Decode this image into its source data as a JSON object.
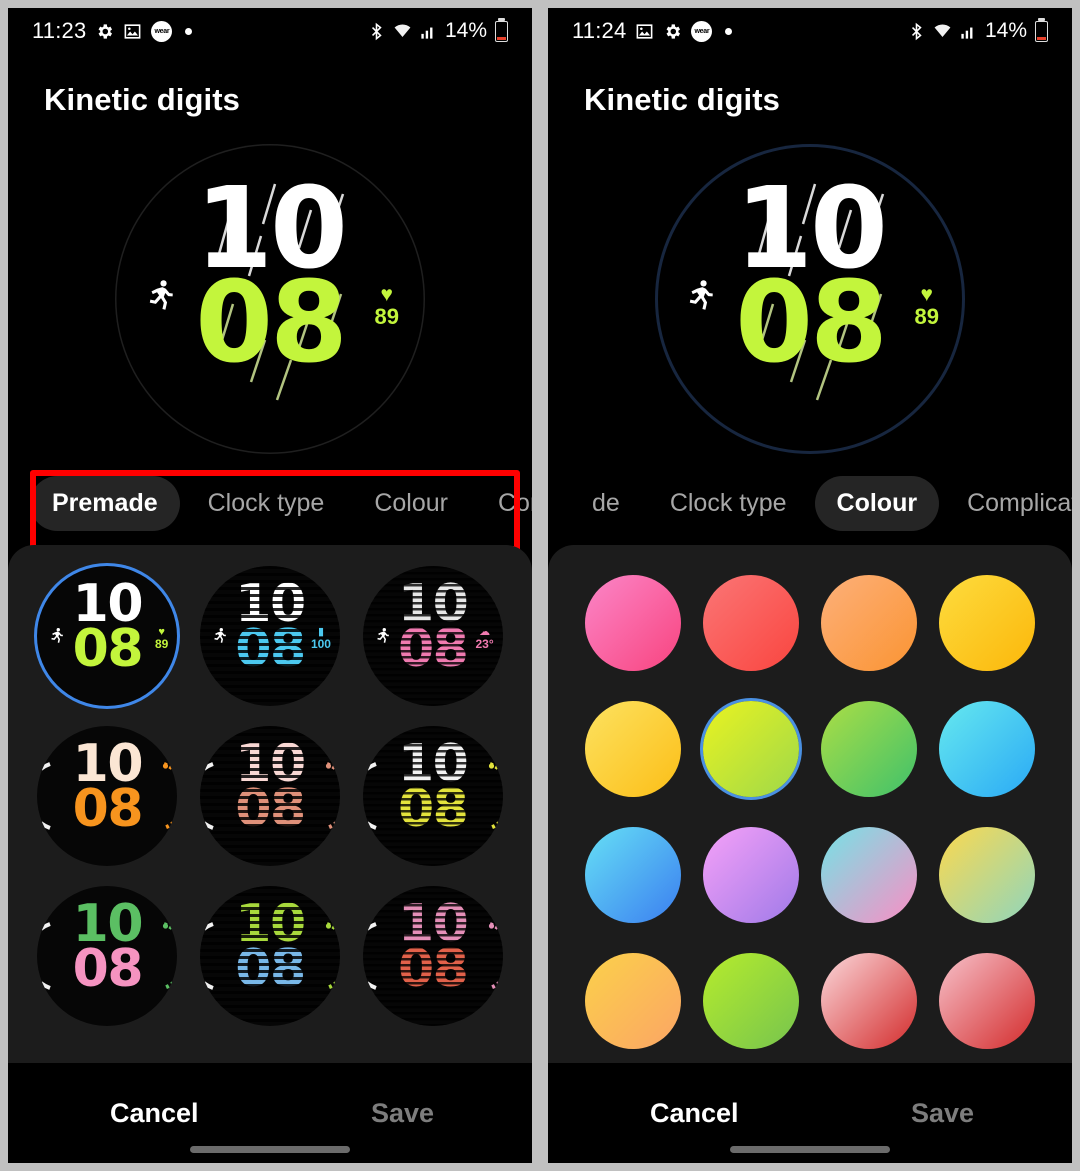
{
  "left_panel": {
    "status_bar": {
      "time": "11:23",
      "battery_percent": "14%",
      "left_icons": [
        "gear-icon",
        "photo-icon",
        "wear-icon",
        "dot-icon"
      ],
      "right_icons": [
        "bluetooth-icon",
        "wifi-icon",
        "signal-icon",
        "battery-icon"
      ],
      "wear_label": "wear"
    },
    "title": "Kinetic digits",
    "watch_preview": {
      "hour": "10",
      "minute": "08",
      "hour_color": "#ffffff",
      "minute_color": "#c3f53c",
      "left_complication_icon": "running-icon",
      "heart_icon": "heart-icon",
      "heart_rate": "89",
      "ring_style": "faint"
    },
    "tabs": [
      {
        "label": "Premade",
        "active": true
      },
      {
        "label": "Clock type",
        "active": false
      },
      {
        "label": "Colour",
        "active": false
      },
      {
        "label": "Complic",
        "active": false
      }
    ],
    "annotation": {
      "type": "red-rectangle",
      "color": "#ff0000",
      "target": "tab-bar"
    },
    "premade_faces": [
      {
        "hour": "10",
        "minute": "08",
        "hour_color": "#ffffff",
        "minute_color": "#c3f53c",
        "style": "solid",
        "selected": true,
        "icon": "running-icon",
        "comp_glyph": "♥",
        "comp_value": "89",
        "comp_color": "#c3f53c"
      },
      {
        "hour": "10",
        "minute": "08",
        "hour_color": "#ffffff",
        "minute_color": "#4cc9f0",
        "style": "stripes",
        "selected": false,
        "icon": "walking-icon",
        "comp_glyph": "▮",
        "comp_value": "100",
        "comp_color": "#4cc9f0"
      },
      {
        "hour": "10",
        "minute": "08",
        "hour_color": "#e8e8e8",
        "minute_color": "#f07ab0",
        "style": "waves",
        "selected": false,
        "icon": "cycling-icon",
        "comp_glyph": "☁",
        "comp_value": "23°",
        "comp_color": "#f07ab0"
      },
      {
        "hour": "10",
        "minute": "08",
        "hour_color": "#fbe6d4",
        "minute_color": "#f7941e",
        "style": "solid",
        "selected": false,
        "icon": "",
        "comp_glyph": "",
        "comp_value": "",
        "comp_color": "#f7941e"
      },
      {
        "hour": "10",
        "minute": "08",
        "hour_color": "#f9d8d4",
        "minute_color": "#e0917a",
        "style": "stripes",
        "selected": false,
        "icon": "",
        "comp_glyph": "",
        "comp_value": "",
        "comp_color": "#e0917a"
      },
      {
        "hour": "10",
        "minute": "08",
        "hour_color": "#f2f2f2",
        "minute_color": "#e3e33c",
        "style": "waves",
        "selected": false,
        "icon": "",
        "comp_glyph": "",
        "comp_value": "",
        "comp_color": "#e3e33c"
      },
      {
        "hour": "10",
        "minute": "08",
        "hour_color": "#5bbf63",
        "minute_color": "#f593c0",
        "style": "solid",
        "selected": false,
        "icon": "",
        "comp_glyph": "",
        "comp_value": "",
        "comp_color": "#5bbf63"
      },
      {
        "hour": "10",
        "minute": "08",
        "hour_color": "#a8d93c",
        "minute_color": "#79b8e8",
        "style": "stripes",
        "selected": false,
        "icon": "",
        "comp_glyph": "",
        "comp_value": "",
        "comp_color": "#a8d93c"
      },
      {
        "hour": "10",
        "minute": "08",
        "hour_color": "#e58fb8",
        "minute_color": "#e2614a",
        "style": "waves",
        "selected": false,
        "icon": "",
        "comp_glyph": "",
        "comp_value": "",
        "comp_color": "#e58fb8"
      }
    ],
    "bottom": {
      "cancel": "Cancel",
      "save": "Save"
    }
  },
  "right_panel": {
    "status_bar": {
      "time": "11:24",
      "battery_percent": "14%",
      "left_icons": [
        "photo-icon",
        "gear-icon",
        "wear-icon",
        "dot-icon"
      ],
      "right_icons": [
        "bluetooth-icon",
        "wifi-icon",
        "signal-icon",
        "battery-icon"
      ],
      "wear_label": "wear"
    },
    "title": "Kinetic digits",
    "watch_preview": {
      "hour": "10",
      "minute": "08",
      "hour_color": "#ffffff",
      "minute_color": "#c3f53c",
      "left_complication_icon": "running-icon",
      "heart_icon": "heart-icon",
      "heart_rate": "89",
      "ring_style": "navy"
    },
    "tabs": [
      {
        "label": "de",
        "active": false
      },
      {
        "label": "Clock type",
        "active": false
      },
      {
        "label": "Colour",
        "active": true
      },
      {
        "label": "Complication typ",
        "active": false
      }
    ],
    "colours": [
      {
        "name": "pink",
        "from": "#fb86c8",
        "to": "#f8447f",
        "selected": false
      },
      {
        "name": "red-coral",
        "from": "#fb7676",
        "to": "#f9453f",
        "selected": false
      },
      {
        "name": "orange-light",
        "from": "#fcb07a",
        "to": "#fb9432",
        "selected": false
      },
      {
        "name": "gold",
        "from": "#fddc3e",
        "to": "#fcb70a",
        "selected": false
      },
      {
        "name": "yellow",
        "from": "#fde260",
        "to": "#fbbe17",
        "selected": false
      },
      {
        "name": "yellow-lime",
        "from": "#eaf320",
        "to": "#9ed84a",
        "selected": true
      },
      {
        "name": "green",
        "from": "#acde45",
        "to": "#3fc16b",
        "selected": false
      },
      {
        "name": "cyan-blue",
        "from": "#66e9ef",
        "to": "#2aa9f5",
        "selected": false
      },
      {
        "name": "blue",
        "from": "#66e0f5",
        "to": "#3b7ef0",
        "selected": false
      },
      {
        "name": "pink-purple",
        "from": "#f6a1f8",
        "to": "#9f7ae8",
        "selected": false
      },
      {
        "name": "cyan-pink",
        "from": "#74e3e6",
        "to": "#fb8ec4",
        "selected": false
      },
      {
        "name": "yellow-teal",
        "from": "#fcd84e",
        "to": "#8fd6bd",
        "selected": false
      },
      {
        "name": "yellow-orange",
        "from": "#fbd14a",
        "to": "#fba565",
        "selected": false
      },
      {
        "name": "lime",
        "from": "#b6ec2c",
        "to": "#76c44e",
        "selected": false
      },
      {
        "name": "pale-pink-red",
        "from": "#fbd9dc",
        "to": "#d32b2b",
        "selected": false
      },
      {
        "name": "pale-pink-red2",
        "from": "#f7c2cb",
        "to": "#d32b2b",
        "selected": false
      }
    ],
    "bottom": {
      "cancel": "Cancel",
      "save": "Save"
    }
  }
}
